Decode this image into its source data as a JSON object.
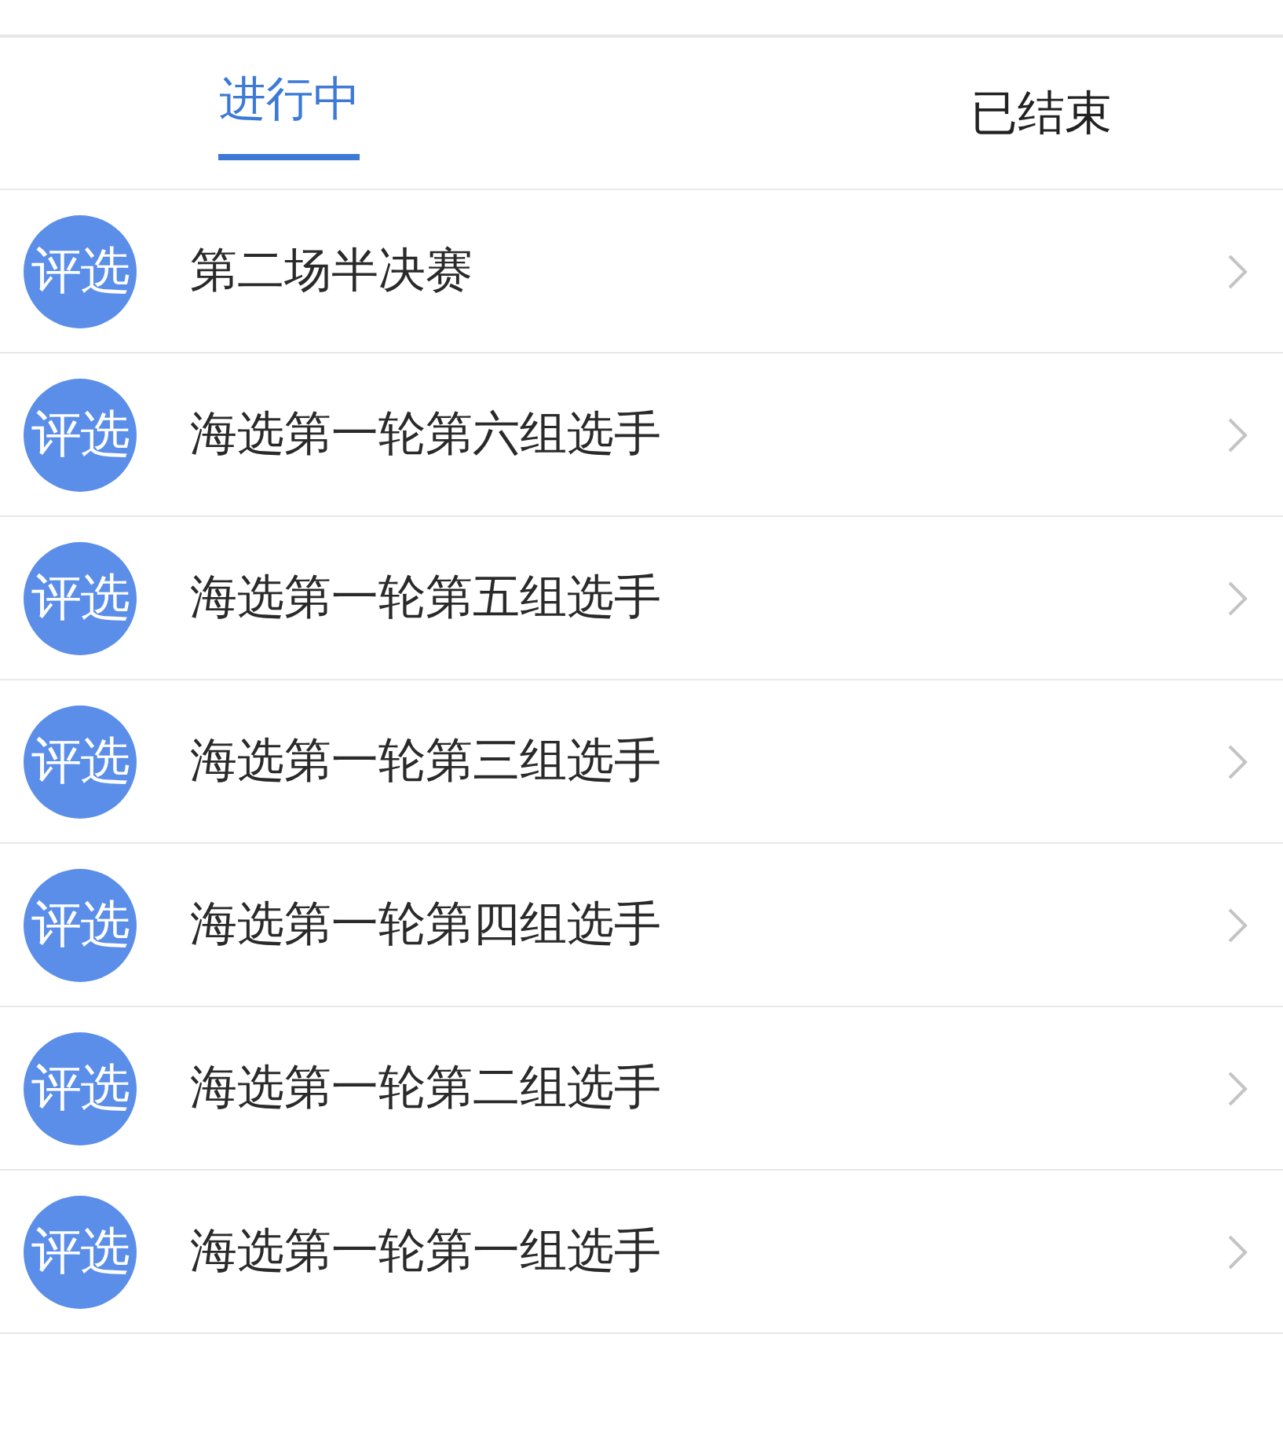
{
  "tabs": [
    {
      "label": "进行中",
      "selected": true
    },
    {
      "label": "已结束",
      "selected": false
    }
  ],
  "items": [
    {
      "badge": "评选",
      "title": "第二场半决赛"
    },
    {
      "badge": "评选",
      "title": "海选第一轮第六组选手"
    },
    {
      "badge": "评选",
      "title": "海选第一轮第五组选手"
    },
    {
      "badge": "评选",
      "title": "海选第一轮第三组选手"
    },
    {
      "badge": "评选",
      "title": "海选第一轮第四组选手"
    },
    {
      "badge": "评选",
      "title": "海选第一轮第二组选手"
    },
    {
      "badge": "评选",
      "title": "海选第一轮第一组选手"
    }
  ]
}
